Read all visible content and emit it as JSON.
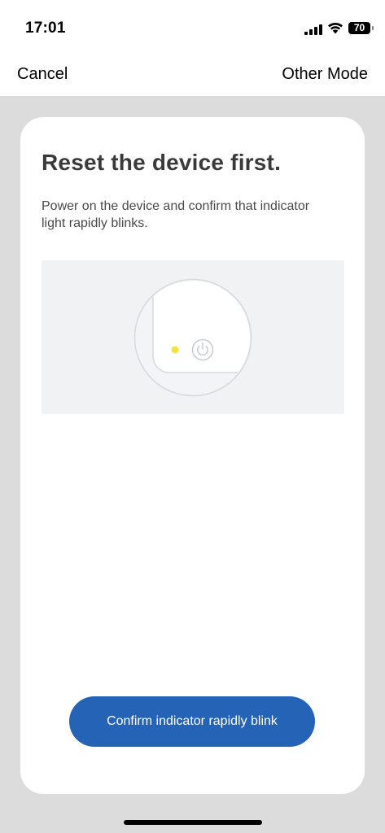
{
  "status_bar": {
    "time": "17:01",
    "battery": "70",
    "icons": [
      "signal-icon",
      "wifi-icon",
      "battery-icon"
    ]
  },
  "nav": {
    "cancel_label": "Cancel",
    "other_mode_label": "Other Mode"
  },
  "card": {
    "title": "Reset the device first.",
    "description": "Power on the device and confirm that indicator light rapidly blinks.",
    "illustration": {
      "indicator_color": "#f4e33c",
      "icons": [
        "power-icon"
      ]
    },
    "confirm_label": "Confirm indicator rapidly blink"
  },
  "colors": {
    "accent": "#2563b6",
    "page_background": "#dcdcdc",
    "card_background": "#ffffff",
    "illustration_background": "#f1f2f4"
  }
}
